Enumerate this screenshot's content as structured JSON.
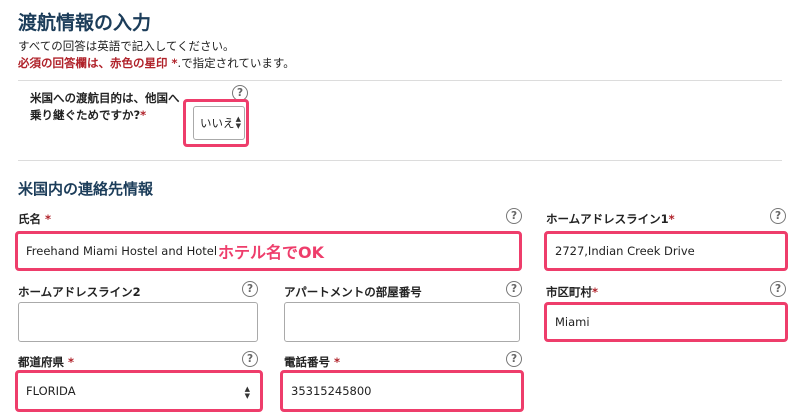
{
  "header": {
    "title": "渡航情報の入力",
    "note_english": "すべての回答は英語で記入してください。",
    "note_required": "必須の回答欄は、赤色の星印 *",
    "note_required_tail": ".で指定されています。"
  },
  "transit": {
    "question": "米国への渡航目的は、他国へ乗り継ぐためですか?",
    "required_mark": "*",
    "help": "?",
    "value": "いいえ",
    "arrows": "▲▼"
  },
  "contact": {
    "section_title": "米国内の連絡先情報",
    "name": {
      "label": "氏名",
      "required": "*",
      "help": "?",
      "value": "Freehand Miami Hostel and Hotel"
    },
    "annotation": "ホテル名でOK",
    "address1": {
      "label": "ホームアドレスライン1",
      "required": "*",
      "help": "?",
      "value": "2727,Indian Creek Drive"
    },
    "address2": {
      "label": "ホームアドレスライン2",
      "help": "?",
      "value": ""
    },
    "apartment": {
      "label": "アパートメントの部屋番号",
      "help": "?",
      "value": ""
    },
    "city": {
      "label": "市区町村",
      "required": "*",
      "help": "?",
      "value": "Miami"
    },
    "state": {
      "label": "都道府県",
      "required": "*",
      "help": "?",
      "value": "FLORIDA",
      "arrows": "▲▼"
    },
    "phone": {
      "label": "電話番号",
      "required": "*",
      "help": "?",
      "value": "35315245800"
    }
  },
  "colors": {
    "accent": "#ee3d6b",
    "heading": "#1c3d5a",
    "required": "#b0222a"
  }
}
